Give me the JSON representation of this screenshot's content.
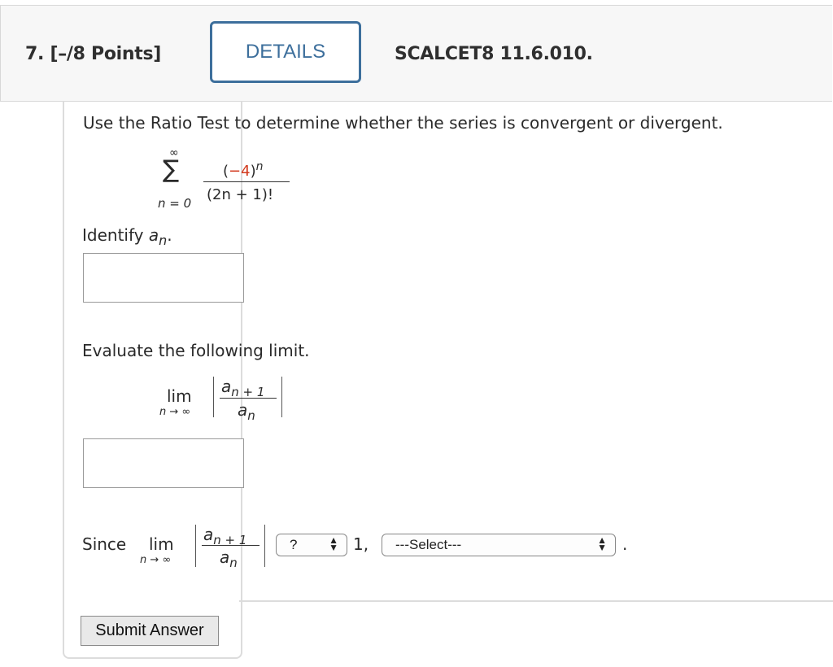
{
  "header": {
    "question_number": "7.",
    "points": "[–/8 Points]",
    "details_label": "DETAILS",
    "problem_code": "SCALCET8 11.6.010."
  },
  "question": {
    "prompt": "Use the Ratio Test to determine whether the series is convergent or divergent.",
    "series": {
      "sum_symbol": "∑",
      "upper": "∞",
      "lower": "n = 0",
      "num_open": "(",
      "num_base": "−4",
      "num_close": ")",
      "num_exp": "n",
      "den": "(2n + 1)!"
    },
    "part1": {
      "label_prefix": "Identify ",
      "label_var": "a",
      "label_sub": "n",
      "label_suffix": "."
    },
    "part2": {
      "label": "Evaluate the following limit.",
      "lim": "lim",
      "lim_under": "n → ∞",
      "num_var": "a",
      "num_sub": "n + 1",
      "den_var": "a",
      "den_sub": "n"
    },
    "part3": {
      "since": "Since",
      "lim": "lim",
      "lim_under": "n → ∞",
      "num_var": "a",
      "num_sub": "n + 1",
      "den_var": "a",
      "den_sub": "n",
      "compare_value": "?",
      "one_text": "1,",
      "conclusion_value": "---Select---",
      "end_period": "."
    },
    "submit_label": "Submit Answer"
  }
}
